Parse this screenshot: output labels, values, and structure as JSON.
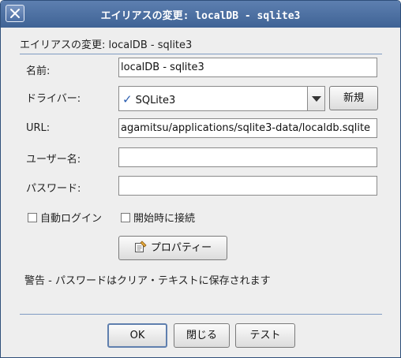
{
  "window": {
    "title": "エイリアスの変更: localDB - sqlite3"
  },
  "header": {
    "text": "エイリアスの変更: localDB - sqlite3"
  },
  "form": {
    "name_label": "名前:",
    "name_value": "localDB - sqlite3",
    "driver_label": "ドライバー:",
    "driver_selected": "SQLite3",
    "driver_check_icon": "checkmark-icon",
    "new_button": "新規",
    "url_label": "URL:",
    "url_value": "agamitsu/applications/sqlite3-data/localdb.sqlite",
    "user_label": "ユーザー名:",
    "user_value": "",
    "password_label": "パスワード:",
    "password_value": ""
  },
  "options": {
    "auto_login": {
      "label": "自動ログイン",
      "checked": false
    },
    "connect_on_start": {
      "label": "開始時に接続",
      "checked": false
    }
  },
  "properties_button": {
    "label": "プロパティー",
    "icon": "properties-icon"
  },
  "warning_text": "警告 - パスワードはクリア・テキストに保存されます",
  "footer": {
    "ok": "OK",
    "close": "閉じる",
    "test": "テスト"
  },
  "colors": {
    "titlebar": "#4a6ea3",
    "separator": "#7f9bc2",
    "check": "#2a5db0"
  }
}
